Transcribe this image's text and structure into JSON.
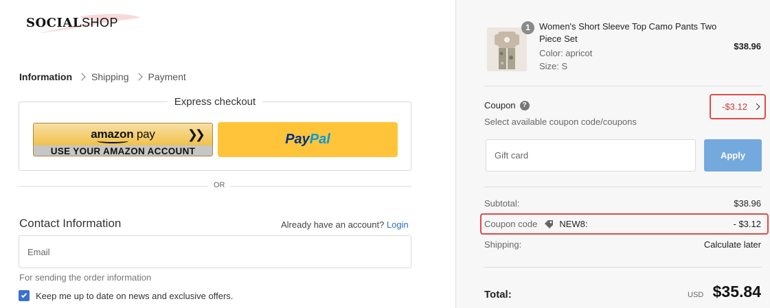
{
  "brand": {
    "logo_bold": "SOCIAL",
    "logo_light": "SHOP"
  },
  "breadcrumb": {
    "items": [
      "Information",
      "Shipping",
      "Payment"
    ]
  },
  "express": {
    "title": "Express checkout",
    "amazon_brand": "amazon",
    "amazon_pay": "pay",
    "amazon_sub": "USE YOUR AMAZON ACCOUNT",
    "paypal_1": "Pay",
    "paypal_2": "Pal"
  },
  "divider_or": "OR",
  "contact": {
    "title": "Contact Information",
    "already": "Already have an account?",
    "login": "Login",
    "email_placeholder": "Email",
    "hint": "For sending the order information",
    "newsletter": "Keep me up to date on news and exclusive offers.",
    "newsletter_checked": true
  },
  "order": {
    "product": {
      "qty": "1",
      "name": "Women's Short Sleeve Top Camo Pants Two Piece Set",
      "color": "Color: apricot",
      "size": "Size: S",
      "price": "$38.96"
    },
    "coupon": {
      "label": "Coupon",
      "sub": "Select available coupon code/coupons",
      "value": "-$3.12"
    },
    "gift_placeholder": "Gift card",
    "apply": "Apply",
    "subtotal_label": "Subtotal:",
    "subtotal": "$38.96",
    "coupon_code_label": "Coupon code",
    "coupon_code": "NEW8:",
    "coupon_discount": "- $3.12",
    "shipping_label": "Shipping:",
    "shipping": "Calculate later",
    "total_label": "Total:",
    "currency": "USD",
    "total": "$35.84"
  },
  "colors": {
    "accent": "#3a6fcf",
    "apply": "#74a9dd",
    "discount": "#d23a3a",
    "highlight": "#e04848"
  }
}
